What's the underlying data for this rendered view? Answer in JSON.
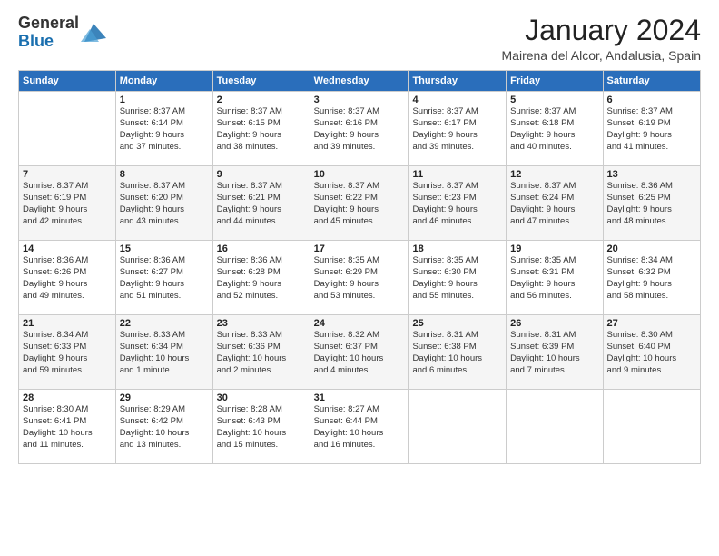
{
  "header": {
    "logo_general": "General",
    "logo_blue": "Blue",
    "title": "January 2024",
    "subtitle": "Mairena del Alcor, Andalusia, Spain"
  },
  "calendar": {
    "days_of_week": [
      "Sunday",
      "Monday",
      "Tuesday",
      "Wednesday",
      "Thursday",
      "Friday",
      "Saturday"
    ],
    "weeks": [
      [
        {
          "day": "",
          "info": ""
        },
        {
          "day": "1",
          "info": "Sunrise: 8:37 AM\nSunset: 6:14 PM\nDaylight: 9 hours\nand 37 minutes."
        },
        {
          "day": "2",
          "info": "Sunrise: 8:37 AM\nSunset: 6:15 PM\nDaylight: 9 hours\nand 38 minutes."
        },
        {
          "day": "3",
          "info": "Sunrise: 8:37 AM\nSunset: 6:16 PM\nDaylight: 9 hours\nand 39 minutes."
        },
        {
          "day": "4",
          "info": "Sunrise: 8:37 AM\nSunset: 6:17 PM\nDaylight: 9 hours\nand 39 minutes."
        },
        {
          "day": "5",
          "info": "Sunrise: 8:37 AM\nSunset: 6:18 PM\nDaylight: 9 hours\nand 40 minutes."
        },
        {
          "day": "6",
          "info": "Sunrise: 8:37 AM\nSunset: 6:19 PM\nDaylight: 9 hours\nand 41 minutes."
        }
      ],
      [
        {
          "day": "7",
          "info": "Sunrise: 8:37 AM\nSunset: 6:19 PM\nDaylight: 9 hours\nand 42 minutes."
        },
        {
          "day": "8",
          "info": "Sunrise: 8:37 AM\nSunset: 6:20 PM\nDaylight: 9 hours\nand 43 minutes."
        },
        {
          "day": "9",
          "info": "Sunrise: 8:37 AM\nSunset: 6:21 PM\nDaylight: 9 hours\nand 44 minutes."
        },
        {
          "day": "10",
          "info": "Sunrise: 8:37 AM\nSunset: 6:22 PM\nDaylight: 9 hours\nand 45 minutes."
        },
        {
          "day": "11",
          "info": "Sunrise: 8:37 AM\nSunset: 6:23 PM\nDaylight: 9 hours\nand 46 minutes."
        },
        {
          "day": "12",
          "info": "Sunrise: 8:37 AM\nSunset: 6:24 PM\nDaylight: 9 hours\nand 47 minutes."
        },
        {
          "day": "13",
          "info": "Sunrise: 8:36 AM\nSunset: 6:25 PM\nDaylight: 9 hours\nand 48 minutes."
        }
      ],
      [
        {
          "day": "14",
          "info": "Sunrise: 8:36 AM\nSunset: 6:26 PM\nDaylight: 9 hours\nand 49 minutes."
        },
        {
          "day": "15",
          "info": "Sunrise: 8:36 AM\nSunset: 6:27 PM\nDaylight: 9 hours\nand 51 minutes."
        },
        {
          "day": "16",
          "info": "Sunrise: 8:36 AM\nSunset: 6:28 PM\nDaylight: 9 hours\nand 52 minutes."
        },
        {
          "day": "17",
          "info": "Sunrise: 8:35 AM\nSunset: 6:29 PM\nDaylight: 9 hours\nand 53 minutes."
        },
        {
          "day": "18",
          "info": "Sunrise: 8:35 AM\nSunset: 6:30 PM\nDaylight: 9 hours\nand 55 minutes."
        },
        {
          "day": "19",
          "info": "Sunrise: 8:35 AM\nSunset: 6:31 PM\nDaylight: 9 hours\nand 56 minutes."
        },
        {
          "day": "20",
          "info": "Sunrise: 8:34 AM\nSunset: 6:32 PM\nDaylight: 9 hours\nand 58 minutes."
        }
      ],
      [
        {
          "day": "21",
          "info": "Sunrise: 8:34 AM\nSunset: 6:33 PM\nDaylight: 9 hours\nand 59 minutes."
        },
        {
          "day": "22",
          "info": "Sunrise: 8:33 AM\nSunset: 6:34 PM\nDaylight: 10 hours\nand 1 minute."
        },
        {
          "day": "23",
          "info": "Sunrise: 8:33 AM\nSunset: 6:36 PM\nDaylight: 10 hours\nand 2 minutes."
        },
        {
          "day": "24",
          "info": "Sunrise: 8:32 AM\nSunset: 6:37 PM\nDaylight: 10 hours\nand 4 minutes."
        },
        {
          "day": "25",
          "info": "Sunrise: 8:31 AM\nSunset: 6:38 PM\nDaylight: 10 hours\nand 6 minutes."
        },
        {
          "day": "26",
          "info": "Sunrise: 8:31 AM\nSunset: 6:39 PM\nDaylight: 10 hours\nand 7 minutes."
        },
        {
          "day": "27",
          "info": "Sunrise: 8:30 AM\nSunset: 6:40 PM\nDaylight: 10 hours\nand 9 minutes."
        }
      ],
      [
        {
          "day": "28",
          "info": "Sunrise: 8:30 AM\nSunset: 6:41 PM\nDaylight: 10 hours\nand 11 minutes."
        },
        {
          "day": "29",
          "info": "Sunrise: 8:29 AM\nSunset: 6:42 PM\nDaylight: 10 hours\nand 13 minutes."
        },
        {
          "day": "30",
          "info": "Sunrise: 8:28 AM\nSunset: 6:43 PM\nDaylight: 10 hours\nand 15 minutes."
        },
        {
          "day": "31",
          "info": "Sunrise: 8:27 AM\nSunset: 6:44 PM\nDaylight: 10 hours\nand 16 minutes."
        },
        {
          "day": "",
          "info": ""
        },
        {
          "day": "",
          "info": ""
        },
        {
          "day": "",
          "info": ""
        }
      ]
    ]
  }
}
